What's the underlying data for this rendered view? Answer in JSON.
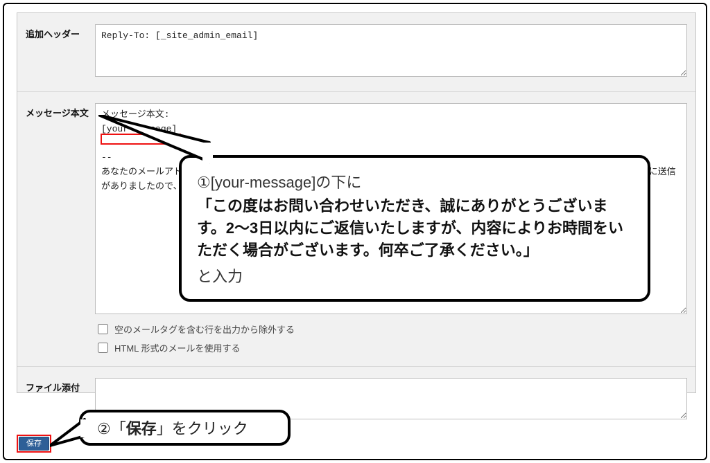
{
  "fields": {
    "additional_headers": {
      "label": "追加ヘッダー",
      "value": "Reply-To: [_site_admin_email]"
    },
    "message_body": {
      "label": "メッセージ本文",
      "value": "メッセージ本文:\n[your-message]\n\n-- \nあなたのメールアドレスを使用して                              ([_site_title] [_site_url]) のコンタクトフォームに送信がありましたので、その控えとして本メールを送りま"
    },
    "checkbox_empty_tag": "空のメールタグを含む行を出力から除外する",
    "checkbox_html": "HTML 形式のメールを使用する",
    "file_attach": {
      "label": "ファイル添付",
      "value": ""
    }
  },
  "save_button": "保存",
  "callout1": {
    "line1": "①[your-message]の下に",
    "line2": "「この度はお問い合わせいただき、誠にありがとうございます。2〜3日以内にご返信いたしますが、内容によりお時間をいただく場合がございます。何卒ご了承ください。」",
    "line3": "と入力"
  },
  "callout2": {
    "pre": "②「",
    "bold": "保存",
    "post": "」をクリック"
  }
}
